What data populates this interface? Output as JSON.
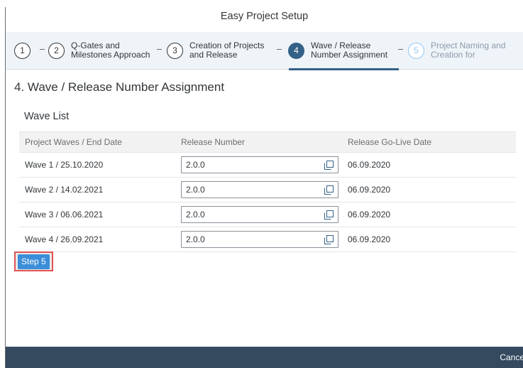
{
  "dialog": {
    "title": "Easy Project Setup"
  },
  "wizard": {
    "steps": [
      {
        "number": "1",
        "label": ""
      },
      {
        "number": "2",
        "label": "Q-Gates and\nMilestones Approach"
      },
      {
        "number": "3",
        "label": "Creation of Projects\nand Release"
      },
      {
        "number": "4",
        "label": "Wave / Release\nNumber Assignment"
      },
      {
        "number": "5",
        "label": "Project Naming and\nCreation for"
      }
    ],
    "active_step": "4"
  },
  "page": {
    "title": "4. Wave / Release Number Assignment",
    "section_title": "Wave List"
  },
  "table": {
    "columns": [
      "Project Waves / End Date",
      "Release Number",
      "Release Go-Live Date"
    ],
    "rows": [
      {
        "wave": "Wave 1 / 25.10.2020",
        "release": "2.0.0",
        "golive": "06.09.2020"
      },
      {
        "wave": "Wave 2 / 14.02.2021",
        "release": "2.0.0",
        "golive": "06.09.2020"
      },
      {
        "wave": "Wave 3 / 06.06.2021",
        "release": "2.0.0",
        "golive": "06.09.2020"
      },
      {
        "wave": "Wave 4 / 26.09.2021",
        "release": "2.0.0",
        "golive": "06.09.2020"
      }
    ]
  },
  "buttons": {
    "step5": "Step 5",
    "cancel": "Cance"
  },
  "colors": {
    "accent": "#346187",
    "footer": "#354a5f",
    "highlight": "#e05353",
    "button": "#3b8ed9"
  }
}
